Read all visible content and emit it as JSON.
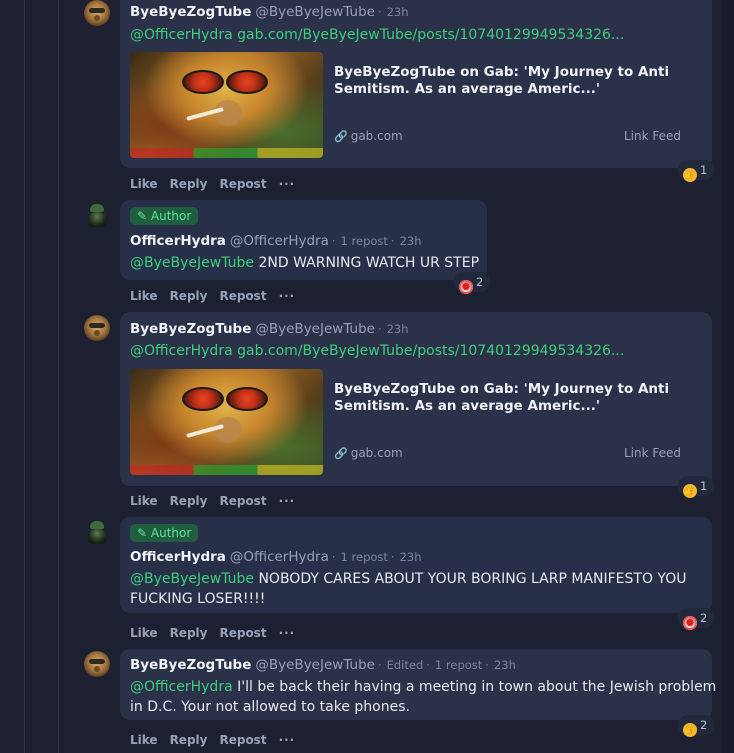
{
  "actions": {
    "like": "Like",
    "reply": "Reply",
    "repost": "Repost",
    "more": "···"
  },
  "colors": {
    "background": "#1c2031",
    "bubble": "#2a3149",
    "mention": "#3ecf7a",
    "author_badge": "#1f5e3e"
  },
  "posts": [
    {
      "name": "ByeByeZogTube",
      "handle": "@ByeByeJewTube",
      "time": "23h",
      "mention": "@OfficerHydra",
      "link": "gab.com/ByeByeJewTube/posts/10740129949534326...",
      "card": {
        "title": "ByeByeZogTube on Gab: 'My Journey to Anti Semitism. As an average Americ...'",
        "domain": "gab.com",
        "source": "Link Feed"
      },
      "reaction": {
        "icon": "thumbs-up-icon",
        "count": "1"
      }
    },
    {
      "badge": "Author",
      "name": "OfficerHydra",
      "handle": "@OfficerHydra",
      "reposts": "1 repost",
      "time": "23h",
      "mention": "@ByeByeJewTube",
      "text": "2ND WARNING WATCH UR STEP",
      "reaction": {
        "icon": "clown-icon",
        "count": "2"
      }
    },
    {
      "name": "ByeByeZogTube",
      "handle": "@ByeByeJewTube",
      "time": "23h",
      "mention": "@OfficerHydra",
      "link": "gab.com/ByeByeJewTube/posts/10740129949534326...",
      "card": {
        "title": "ByeByeZogTube on Gab: 'My Journey to Anti Semitism. As an average Americ...'",
        "domain": "gab.com",
        "source": "Link Feed"
      },
      "reaction": {
        "icon": "thumbs-up-icon",
        "count": "1"
      }
    },
    {
      "badge": "Author",
      "name": "OfficerHydra",
      "handle": "@OfficerHydra",
      "reposts": "1 repost",
      "time": "23h",
      "mention": "@ByeByeJewTube",
      "text": "NOBODY CARES ABOUT YOUR BORING LARP MANIFESTO YOU",
      "text2": "FUCKING LOSER!!!!",
      "reaction": {
        "icon": "clown-icon",
        "count": "2"
      }
    },
    {
      "name": "ByeByeZogTube",
      "handle": "@ByeByeJewTube",
      "edited": "Edited",
      "reposts": "1 repost",
      "time": "23h",
      "mention": "@OfficerHydra",
      "text": "I'll be back their having a meeting in town about the Jewish problem",
      "text2": "in D.C. Your not allowed to take phones.",
      "reaction": {
        "icon": "thumbs-up-icon",
        "count": "2"
      }
    }
  ]
}
